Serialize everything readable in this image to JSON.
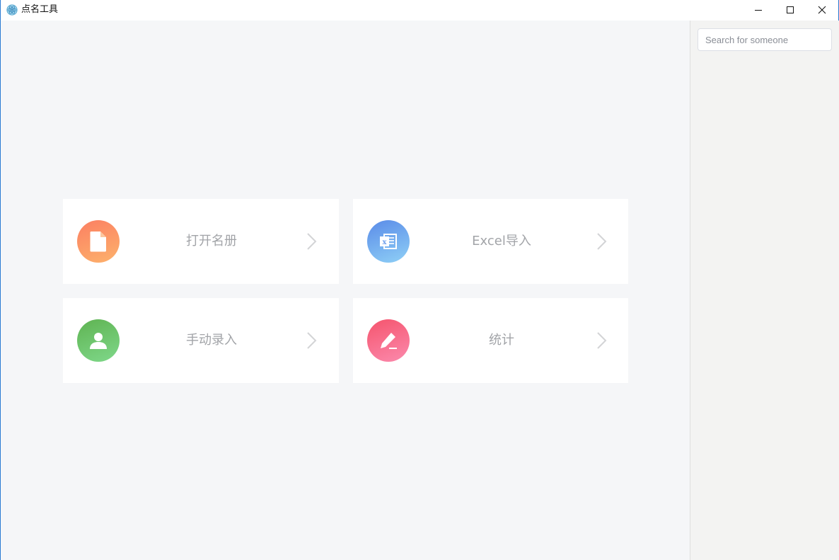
{
  "window": {
    "title": "点名工具",
    "icon": "app-logo-icon",
    "controls": [
      "minimize-icon",
      "maximize-icon",
      "close-icon"
    ]
  },
  "sidebar": {
    "search": {
      "placeholder": "Search for someone",
      "value": ""
    }
  },
  "menu": {
    "cards": [
      {
        "label": "打开名册",
        "icon": "document-icon",
        "color": "#fb8f64"
      },
      {
        "label": "Excel导入",
        "icon": "excel-icon",
        "color": "#6e9fec"
      },
      {
        "label": "手动录入",
        "icon": "user-icon",
        "color": "#6cc36a"
      },
      {
        "label": "统计",
        "icon": "pencil-icon",
        "color": "#f6647f"
      }
    ]
  }
}
